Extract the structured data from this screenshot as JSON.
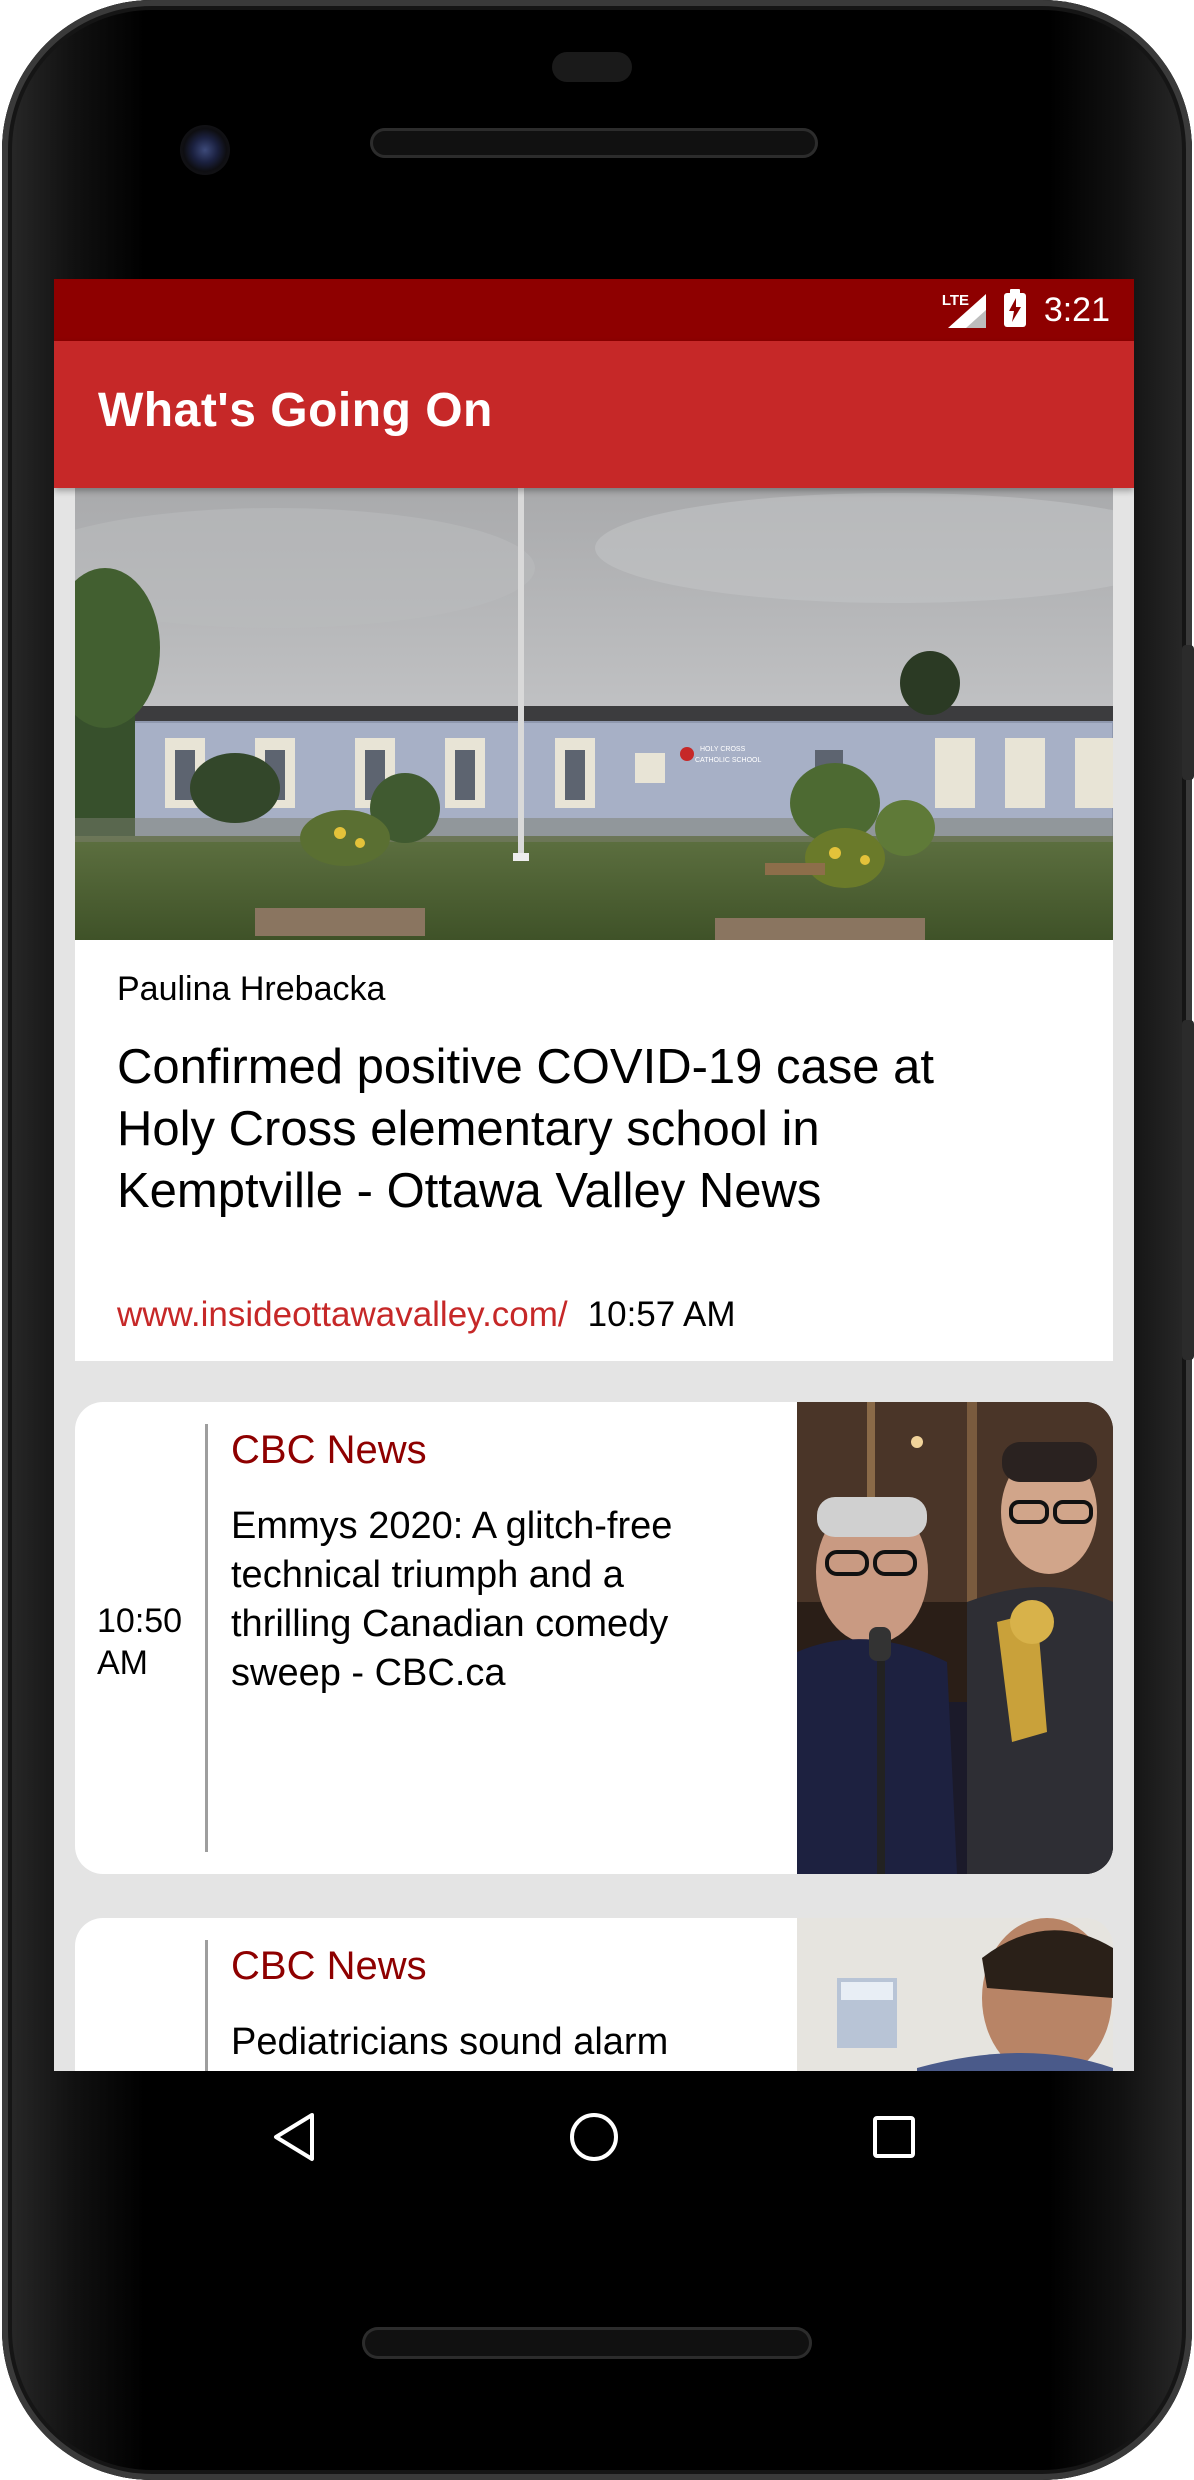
{
  "status_bar": {
    "network_label": "LTE",
    "time": "3:21"
  },
  "app_bar": {
    "title": "What's Going On"
  },
  "featured_article": {
    "author": "Paulina Hrebacka",
    "headline": "Confirmed positive COVID-19 case at Holy Cross elementary school in Kemptville - Ottawa Valley News",
    "source_url": "www.insideottawavalley.com/",
    "time": "10:57 AM",
    "image_sign_text": "HOLY CROSS CATHOLIC SCHOOL"
  },
  "articles": [
    {
      "time": "10:50 AM",
      "source": "CBC News",
      "title": "Emmys 2020: A glitch-free technical triumph and a thrilling Canadian comedy sweep - CBC.ca"
    },
    {
      "time": "",
      "source": "CBC News",
      "title": "Pediatricians sound alarm"
    }
  ],
  "nav_bar": {
    "back": "back-icon",
    "home": "home-icon",
    "recents": "recents-icon"
  },
  "colors": {
    "status_bar": "#8e0000",
    "app_bar": "#c62828",
    "source_text": "#8e0000",
    "link": "#c62828"
  }
}
